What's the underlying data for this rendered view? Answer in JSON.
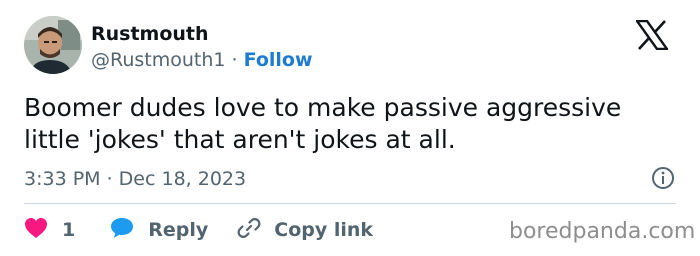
{
  "author": {
    "display_name": "Rustmouth",
    "handle": "@Rustmouth1",
    "separator": "·",
    "follow_label": "Follow"
  },
  "tweet": {
    "text": "Boomer dudes love to make passive aggressive little 'jokes' that aren't jokes at all.",
    "timestamp": "3:33 PM · Dec 18, 2023"
  },
  "actions": {
    "likes_count": "1",
    "reply_label": "Reply",
    "copy_link_label": "Copy link"
  },
  "watermark": "boredpanda.com",
  "colors": {
    "like_heart": "#f91880",
    "reply_bubble": "#1d9bf0",
    "link_blue": "#1d7bd2",
    "secondary_text": "#536471"
  },
  "icons": {
    "platform_logo": "x-logo-icon",
    "info": "info-icon",
    "like": "heart-icon",
    "reply": "speech-bubble-icon",
    "copy_link": "link-icon"
  }
}
